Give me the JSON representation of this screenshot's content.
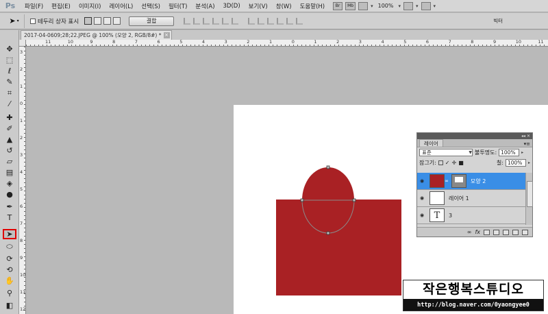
{
  "app": {
    "logo": "Ps"
  },
  "menu": {
    "items": [
      "파일(F)",
      "편집(E)",
      "이미지(I)",
      "레이어(L)",
      "선택(S)",
      "필터(T)",
      "분석(A)",
      "3D(D)",
      "보기(V)",
      "창(W)",
      "도움말(H)"
    ],
    "br_label": "Br",
    "mb_label": "Mb",
    "zoom": "100%"
  },
  "options": {
    "show_bounding_box": "테두리 상자 표시",
    "combine_button": "결합",
    "workspace": "빅터"
  },
  "document": {
    "tab_title": "2017-04-0609;28;22.JPEG @ 100% (모양 2, RGB/8#) *",
    "close_glyph": "×"
  },
  "rulers": {
    "top": [
      "11",
      "10",
      "9",
      "8",
      "7",
      "6",
      "5",
      "4",
      "3",
      "2",
      "1",
      "0",
      "1",
      "2",
      "3",
      "4",
      "5",
      "6",
      "7",
      "8",
      "9",
      "10",
      "11"
    ],
    "left": [
      "3",
      "2",
      "1",
      "0",
      "1",
      "2",
      "3",
      "4",
      "5",
      "6",
      "7",
      "8",
      "9",
      "10",
      "11",
      "12"
    ]
  },
  "layers_panel": {
    "tab_label": "레이어",
    "blend_mode": "표준",
    "opacity_label": "불투명도:",
    "opacity_value": "100%",
    "lock_label": "잠그기:",
    "fill_label": "칠:",
    "fill_value": "100%",
    "layers": [
      {
        "name": "모양 2",
        "type": "shape",
        "selected": true
      },
      {
        "name": "레이어 1",
        "type": "pixel",
        "selected": false
      },
      {
        "name": "3",
        "type": "text",
        "selected": false
      }
    ],
    "text_thumb_glyph": "T"
  },
  "artwork": {
    "shape_color": "#a92124"
  },
  "watermark": {
    "title": "작은행복스튜디오",
    "url": "http://blog.naver.com/0yaongyee0"
  }
}
